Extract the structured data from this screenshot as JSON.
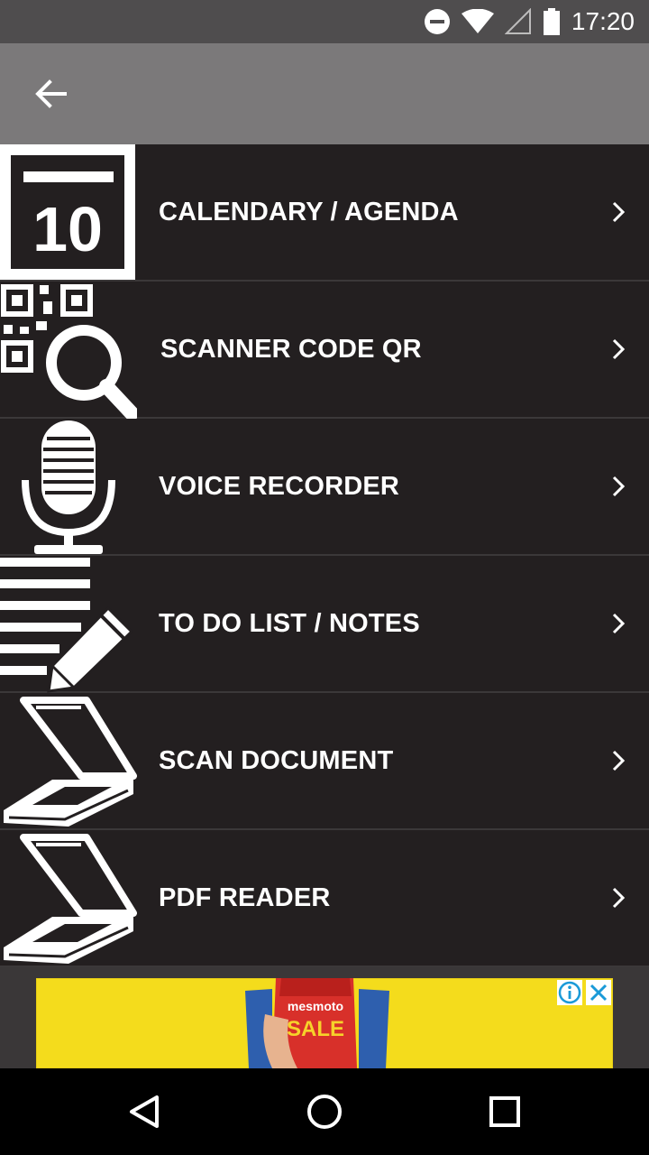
{
  "status_bar": {
    "time": "17:20",
    "icons": [
      "do-not-disturb-icon",
      "wifi-icon",
      "cell-signal-icon",
      "battery-icon"
    ]
  },
  "app_bar": {
    "back_icon": "arrow-back-icon"
  },
  "menu": {
    "items": [
      {
        "label": "CALENDARY / AGENDA",
        "icon": "calendar-icon"
      },
      {
        "label": "SCANNER CODE QR",
        "icon": "qr-scan-icon"
      },
      {
        "label": "VOICE RECORDER",
        "icon": "microphone-icon"
      },
      {
        "label": "TO DO LIST / NOTES",
        "icon": "notes-pencil-icon"
      },
      {
        "label": "SCAN DOCUMENT",
        "icon": "scanner-icon"
      },
      {
        "label": "PDF READER",
        "icon": "scanner-icon"
      }
    ],
    "calendar_day": "10"
  },
  "ad": {
    "brand": "mesmoto",
    "text": "SALE",
    "info_icon": "info-icon",
    "close_icon": "close-icon"
  },
  "nav_bar": {
    "buttons": [
      "back-triangle-icon",
      "home-circle-icon",
      "recents-square-icon"
    ]
  },
  "colors": {
    "status_bar": "#4f4d4e",
    "app_bar": "#7b797a",
    "list_bg": "#231f20",
    "ad_yellow": "#f4dc1c"
  }
}
